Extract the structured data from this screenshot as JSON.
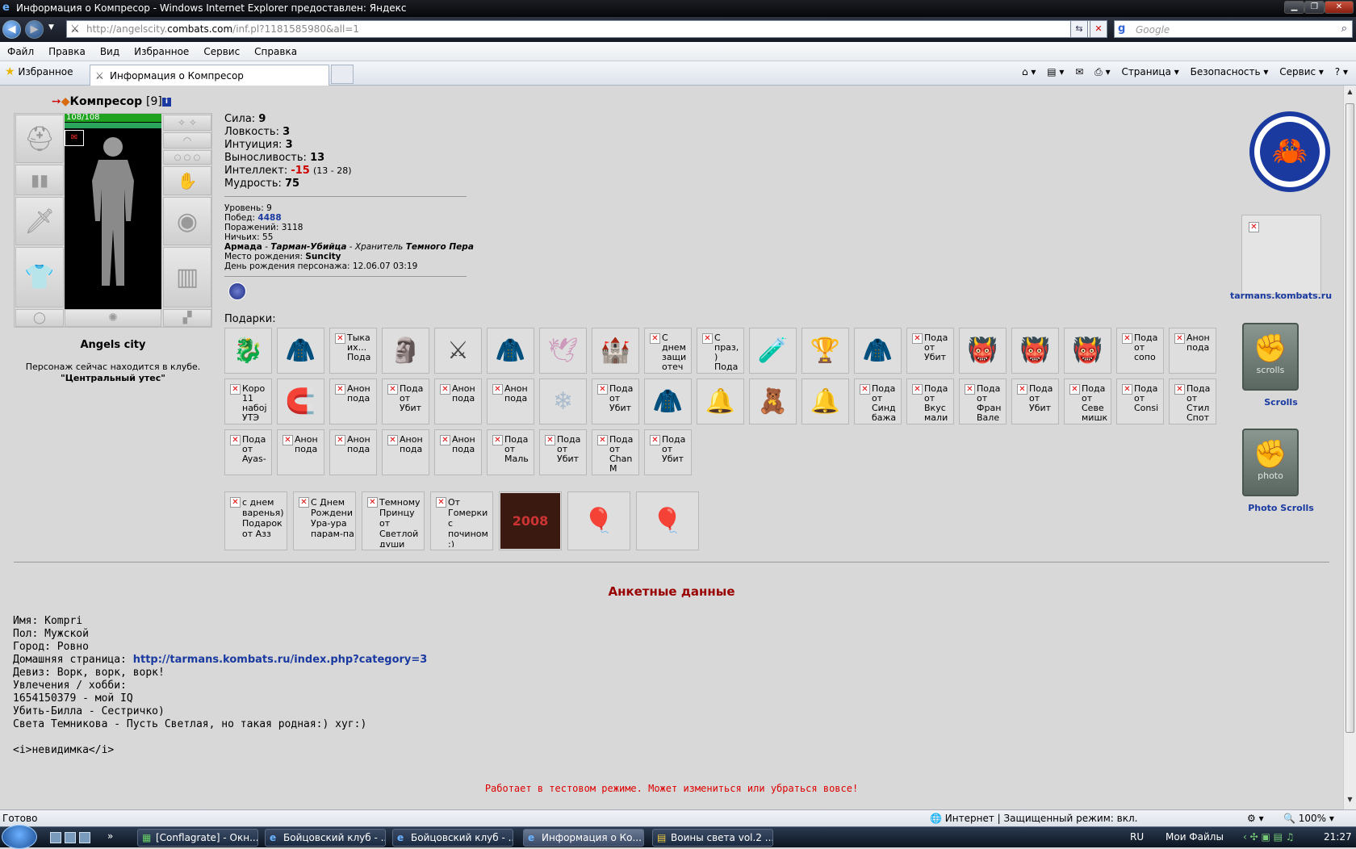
{
  "window": {
    "title": "Информация о Компресор - Windows Internet Explorer предоставлен: Яндекс"
  },
  "nav": {
    "url_pre": "http://angelscity.",
    "url_domain": "combats.com",
    "url_post": "/inf.pl?1181585980&all=1",
    "search_placeholder": "Google"
  },
  "menu": [
    "Файл",
    "Правка",
    "Вид",
    "Избранное",
    "Сервис",
    "Справка"
  ],
  "favbar": {
    "favorites": "Избранное",
    "tab": "Информация о Компресор",
    "tools": [
      "Страница ▾",
      "Безопасность ▾",
      "Сервис ▾",
      "? ▾"
    ]
  },
  "character": {
    "name": "Компресор",
    "level": "[9]",
    "hp": "108/108",
    "location_name": "Angels city",
    "location_desc": "Персонаж сейчас находится в клубе.",
    "location_place": "\"Центральный утес\""
  },
  "stats": {
    "sila_label": "Сила:",
    "sila": "9",
    "lovk_label": "Ловкость:",
    "lovk": "3",
    "intu_label": "Интуиция:",
    "intu": "3",
    "vyn_label": "Выносливость:",
    "vyn": "13",
    "intel_label": "Интеллект:",
    "intel": "-15",
    "intel_range": "(13 - 28)",
    "mudr_label": "Мудрость:",
    "mudr": "75"
  },
  "stats2": {
    "level": "Уровень: 9",
    "wins_label": "Побед:",
    "wins": "4488",
    "losses": "Поражений: 3118",
    "draws": "Ничьих: 55",
    "clan_a": "Армада",
    "clan_b": "Тарман-Убийца",
    "clan_c": "Хранитель",
    "clan_d": "Темного Пера",
    "birthplace_label": "Место рождения:",
    "birthplace": "Suncity",
    "birthday": "День рождения персонажа: 12.06.07 03:19"
  },
  "gifts_label": "Подарки:",
  "gifts_row1": [
    {
      "t": "",
      "i": "🐉",
      "c": "#d8a010"
    },
    {
      "t": "",
      "i": "🧥",
      "c": "#1a9a30"
    },
    {
      "t": "Тыка их... Пода",
      "i": "",
      "c": ""
    },
    {
      "t": "",
      "i": "🗿",
      "c": "#777"
    },
    {
      "t": "",
      "i": "⚔",
      "c": "#444"
    },
    {
      "t": "",
      "i": "🧥",
      "c": "#b01818"
    },
    {
      "t": "",
      "i": "🕊",
      "c": "#c9b"
    },
    {
      "t": "",
      "i": "🏰",
      "c": "#a85"
    },
    {
      "t": "С днем защи отеч",
      "i": "",
      "c": ""
    },
    {
      "t": "С праз, ) Пода",
      "i": "",
      "c": ""
    },
    {
      "t": "",
      "i": "🧪",
      "c": "#a3c"
    },
    {
      "t": "",
      "i": "🏆",
      "c": "#777"
    },
    {
      "t": "",
      "i": "🧥",
      "c": "#b01818"
    },
    {
      "t": "Пода от Убит",
      "i": "",
      "c": ""
    },
    {
      "t": "",
      "i": "👹",
      "c": "#a43"
    },
    {
      "t": "",
      "i": "👹",
      "c": "#a43"
    },
    {
      "t": "",
      "i": "👹",
      "c": "#a43"
    },
    {
      "t": "Пода от сопо",
      "i": "",
      "c": ""
    },
    {
      "t": "Анон пода",
      "i": "",
      "c": ""
    }
  ],
  "gifts_row2": [
    {
      "t": "Коро 11 набој УТЭ",
      "i": "",
      "c": ""
    },
    {
      "t": "",
      "i": "🧲",
      "c": "#a86"
    },
    {
      "t": "Анон пода",
      "i": "",
      "c": ""
    },
    {
      "t": "Пода от Убит",
      "i": "",
      "c": ""
    },
    {
      "t": "Анон пода",
      "i": "",
      "c": ""
    },
    {
      "t": "Анон пода",
      "i": "",
      "c": ""
    },
    {
      "t": "",
      "i": "❄",
      "c": "#abc"
    },
    {
      "t": "Пода от Убит",
      "i": "",
      "c": ""
    },
    {
      "t": "",
      "i": "🧥",
      "c": "#555"
    },
    {
      "t": "",
      "i": "🔔",
      "c": "#e8b400"
    },
    {
      "t": "",
      "i": "🧸",
      "c": "#a22"
    },
    {
      "t": "",
      "i": "🔔",
      "c": "#e8b400"
    },
    {
      "t": "Пода от Синд бажа",
      "i": "",
      "c": ""
    },
    {
      "t": "Пода от Вкус мали",
      "i": "",
      "c": ""
    },
    {
      "t": "Пода от Фран Вале",
      "i": "",
      "c": ""
    },
    {
      "t": "Пода от Убит",
      "i": "",
      "c": ""
    },
    {
      "t": "Пода от Севе мишк",
      "i": "",
      "c": ""
    },
    {
      "t": "Пода от Consi",
      "i": "",
      "c": ""
    },
    {
      "t": "Пода от Стил Спот",
      "i": "",
      "c": ""
    }
  ],
  "gifts_row3": [
    {
      "t": "Пода от Ayas-",
      "i": "",
      "c": ""
    },
    {
      "t": "Анон пода",
      "i": "",
      "c": ""
    },
    {
      "t": "Анон пода",
      "i": "",
      "c": ""
    },
    {
      "t": "Анон пода",
      "i": "",
      "c": ""
    },
    {
      "t": "Анон пода",
      "i": "",
      "c": ""
    },
    {
      "t": "Пода от Маль",
      "i": "",
      "c": ""
    },
    {
      "t": "Пода от Убит",
      "i": "",
      "c": ""
    },
    {
      "t": "Пода от Chan M",
      "i": "",
      "c": ""
    },
    {
      "t": "Пода от Убит",
      "i": "",
      "c": ""
    }
  ],
  "gifts_row4": [
    {
      "t": "с днем варенья) Подарок от Азз",
      "i": "",
      "c": ""
    },
    {
      "t": "С Днем Рождени Ура-ура парам-па",
      "i": "",
      "c": ""
    },
    {
      "t": "Темному Принцу от Светлой души",
      "i": "",
      "c": ""
    },
    {
      "t": "От Гомерки с почином :)",
      "i": "",
      "c": ""
    },
    {
      "t": "",
      "i": "2008",
      "c": "#c33"
    },
    {
      "t": "",
      "i": "🎈",
      "c": "#d62"
    },
    {
      "t": "",
      "i": "🎈",
      "c": "#d62"
    }
  ],
  "right": {
    "banner_link": "tarmans.kombats.ru",
    "scrolls_label": "Scrolls",
    "photo_label": "Photo Scrolls",
    "scroll_word": "scrolls",
    "photo_word": "photo"
  },
  "anketa": {
    "title": "Анкетные данные",
    "name": "Имя: Kompri",
    "sex": "Пол: Мужской",
    "city": "Город: Ровно",
    "home_label": "Домашняя страница: ",
    "home_url": "http://tarmans.kombats.ru/index.php?category=3",
    "motto": "Девиз: Ворк, ворк, ворк!",
    "hobby_label": "Увлечения / хобби:",
    "hobby1": "1654150379 - мой IQ",
    "hobby2": "Убить-Билла - Сестричко)",
    "hobby3": "Света Темникова - Пусть Светлая, но такая родная:) хуг:)",
    "hobby4": "<i>невидимка</i>"
  },
  "test_msg": "Работает в тестовом режиме. Может измениться или убраться вовсе!",
  "status": {
    "left": "Готово",
    "zone": "Интернет | Защищенный режим: вкл.",
    "zoom": "100%"
  },
  "taskbar": {
    "tasks": [
      "[Conflagrate] - Окн...",
      "Бойцовский клуб - ...",
      "Бойцовский клуб - ...",
      "Информация о Ко...",
      "Воины света vol.2 ..."
    ],
    "lang": "RU",
    "myfiles": "Мои Файлы",
    "time": "21:27"
  }
}
